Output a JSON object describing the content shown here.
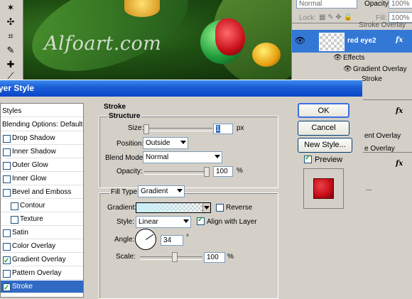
{
  "canvas": {
    "watermark": "Alfoart.com"
  },
  "layers_panel": {
    "blend_mode": "Normal",
    "opacity_label": "Opacity:",
    "opacity_value": "100%",
    "lock_label": "Lock:",
    "fill_label": "Fill:",
    "fill_value": "100%",
    "partial_text_top": "Stroke Overlay",
    "selected_layer": "red eye2",
    "fx": "fx",
    "effects_label": "Effects",
    "effect_1": "Gradient Overlay",
    "effect_2": "Stroke",
    "lower_text_1": "ent Overlay",
    "lower_text_2": "e Overlay",
    "lower_text_3": "..."
  },
  "dialog": {
    "title": "yer Style",
    "styles_header": "Styles",
    "blending_options": "Blending Options: Default",
    "style_items": [
      {
        "label": "Drop Shadow",
        "checked": false
      },
      {
        "label": "Inner Shadow",
        "checked": false
      },
      {
        "label": "Outer Glow",
        "checked": false
      },
      {
        "label": "Inner Glow",
        "checked": false
      },
      {
        "label": "Bevel and Emboss",
        "checked": false
      },
      {
        "label": "Contour",
        "checked": false
      },
      {
        "label": "Texture",
        "checked": false
      },
      {
        "label": "Satin",
        "checked": false
      },
      {
        "label": "Color Overlay",
        "checked": false
      },
      {
        "label": "Gradient Overlay",
        "checked": true
      },
      {
        "label": "Pattern Overlay",
        "checked": false
      },
      {
        "label": "Stroke",
        "checked": true
      }
    ],
    "stroke": {
      "section_title": "Stroke",
      "structure_title": "Structure",
      "size_label": "Size:",
      "size_value": "1",
      "size_unit": "px",
      "position_label": "Position:",
      "position_value": "Outside",
      "blend_mode_label": "Blend Mode:",
      "blend_mode_value": "Normal",
      "opacity_label": "Opacity:",
      "opacity_value": "100",
      "opacity_unit": "%",
      "fill_type_label": "Fill Type:",
      "fill_type_value": "Gradient",
      "gradient_label": "Gradient:",
      "reverse_label": "Reverse",
      "reverse_checked": false,
      "style_label": "Style:",
      "style_value": "Linear",
      "align_label": "Align with Layer",
      "align_checked": true,
      "angle_label": "Angle:",
      "angle_value": "34",
      "angle_unit": "°",
      "scale_label": "Scale:",
      "scale_value": "100",
      "scale_unit": "%"
    },
    "buttons": {
      "ok": "OK",
      "cancel": "Cancel",
      "new_style": "New Style...",
      "preview_label": "Preview",
      "preview_checked": true
    }
  },
  "colors": {
    "title_blue": "#0a46c8",
    "selected_blue": "#3478d6",
    "preview_red": "#c8101a",
    "gradient_start": "#c8f0f8"
  }
}
